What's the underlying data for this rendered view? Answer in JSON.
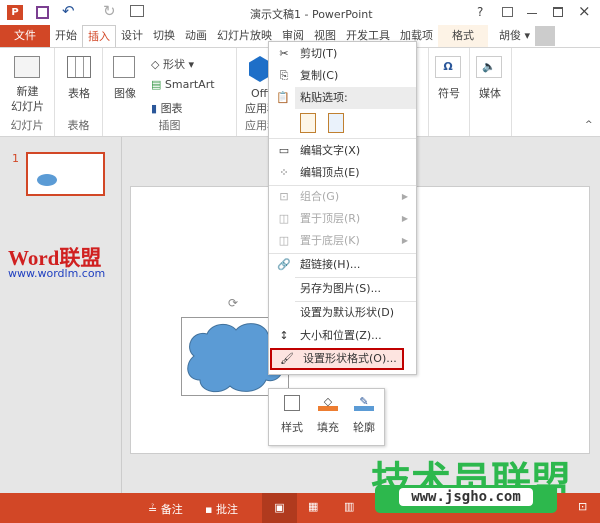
{
  "window": {
    "title": "演示文稿1 - PowerPoint",
    "help": "?",
    "app_icon": "P"
  },
  "tabs": [
    "文件",
    "开始",
    "插入",
    "设计",
    "切换",
    "动画",
    "幻灯片放映",
    "审阅",
    "视图",
    "开发工具",
    "加载项",
    "格式"
  ],
  "user": "胡俊",
  "ribbon": {
    "new_slide": "新建\n幻灯片",
    "table": "表格",
    "image": "图像",
    "shapes": "形状",
    "smartart": "SmartArt",
    "chart": "图表",
    "office_app": "Office\n应用程序",
    "symbol": "符号",
    "media": "媒体",
    "groups": [
      "幻灯片",
      "表格",
      "插图",
      "应用程序"
    ]
  },
  "slide_panel": {
    "number": "1"
  },
  "watermark": {
    "word": "Word联盟",
    "url": "www.wordlm.com",
    "brand": "技术员联盟",
    "brand_url": "www.jsgho.com"
  },
  "context_menu": {
    "cut": "剪切(T)",
    "copy": "复制(C)",
    "paste_options": "粘贴选项:",
    "edit_text": "编辑文字(X)",
    "edit_points": "编辑顶点(E)",
    "group": "组合(G)",
    "bring_front": "置于顶层(R)",
    "send_back": "置于底层(K)",
    "hyperlink": "超链接(H)...",
    "save_as_picture": "另存为图片(S)...",
    "set_default": "设置为默认形状(D)",
    "size_position": "大小和位置(Z)...",
    "format_shape": "设置形状格式(O)..."
  },
  "mini_toolbar": {
    "style": "样式",
    "fill": "填充",
    "outline": "轮廓"
  },
  "status": {
    "notes": "备注",
    "comments": "批注"
  },
  "colors": {
    "accent": "#d24726",
    "shape": "#5b9bd5",
    "highlight": "#c00000",
    "brand_green": "#2db84d"
  }
}
